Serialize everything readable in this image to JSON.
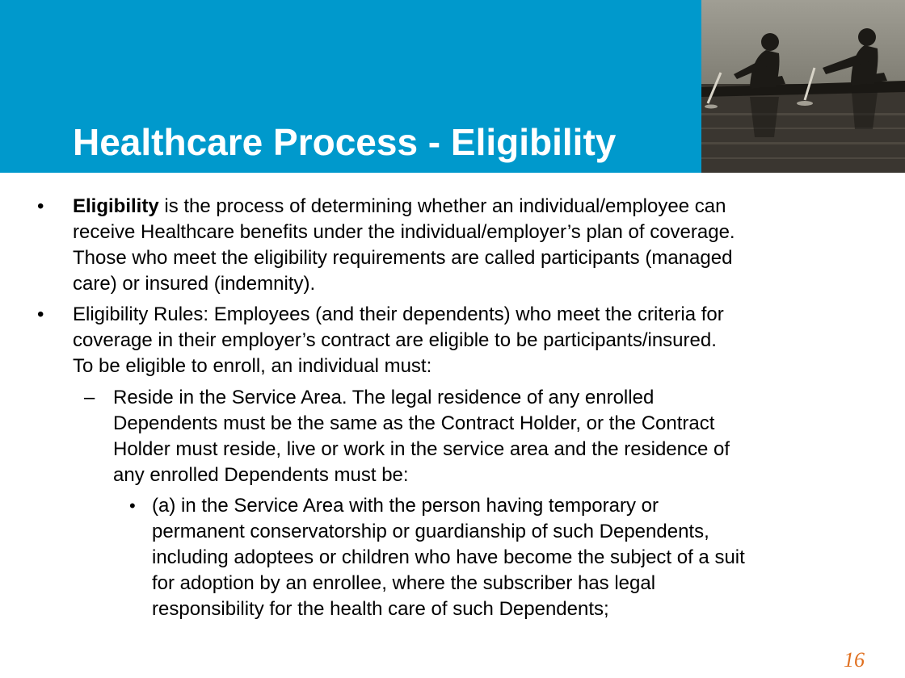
{
  "slide": {
    "title": "Healthcare Process - Eligibility",
    "page_number": "16",
    "colors": {
      "header": "#0099cc",
      "title_text": "#ffffff",
      "page_number": "#e07020"
    },
    "photo_icon": "rowers-photo"
  },
  "bullets": {
    "b1": {
      "marker": "•",
      "term": "Eligibility",
      "line1_rest": " is the process of determining whether an individual/employee can",
      "line2": "receive Healthcare benefits under the individual/employer’s plan of coverage.",
      "line3": "Those who meet the eligibility requirements are called participants (managed",
      "line4": "care) or insured (indemnity)."
    },
    "b2": {
      "marker": "•",
      "line1": "Eligibility Rules: Employees (and their dependents) who meet the criteria for",
      "line2": "coverage in their employer’s contract are eligible to be participants/insured.",
      "line3": "To be eligible to enroll, an individual must:"
    },
    "sub1": {
      "marker": "–",
      "line1": "Reside in the Service Area. The legal residence of any enrolled",
      "line2": "Dependents must be the same as the Contract Holder, or the Contract",
      "line3": "Holder must reside, live or work in the service area and the residence of",
      "line4": "any enrolled Dependents must be:"
    },
    "subsub1": {
      "marker": "•",
      "line1": "(a) in the Service Area with the person having temporary or",
      "line2": "permanent conservatorship or guardianship of such Dependents,",
      "line3": "including adoptees or children who have become the subject of a suit",
      "line4": "for adoption by an enrollee, where the subscriber has legal",
      "line5": "responsibility for the health care of such Dependents;"
    }
  }
}
